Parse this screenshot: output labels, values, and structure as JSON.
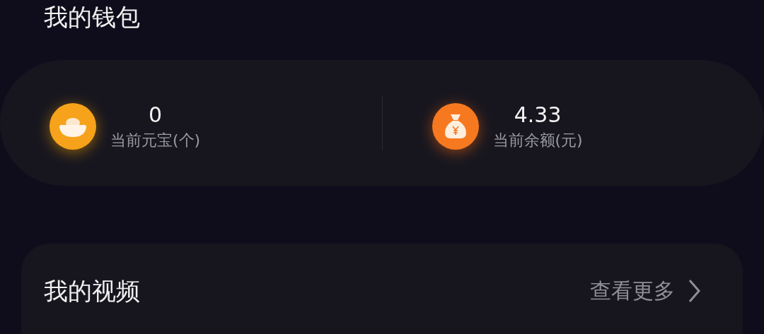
{
  "wallet": {
    "title": "我的钱包",
    "stats": [
      {
        "kind": "ingot",
        "value": "0",
        "label": "当前元宝(个)"
      },
      {
        "kind": "money",
        "value": "4.33",
        "label": "当前余额(元)"
      }
    ]
  },
  "videos": {
    "title": "我的视频",
    "more": "查看更多"
  }
}
